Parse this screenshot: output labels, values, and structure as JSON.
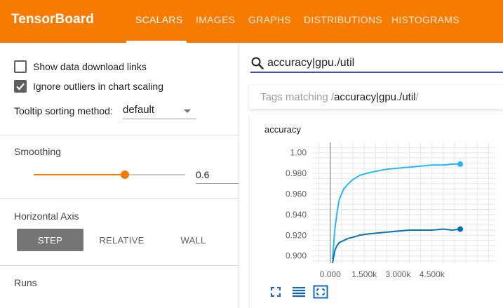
{
  "header": {
    "brand": "TensorBoard",
    "tabs": [
      {
        "label": "SCALARS",
        "active": true
      },
      {
        "label": "IMAGES",
        "active": false
      },
      {
        "label": "GRAPHS",
        "active": false
      },
      {
        "label": "DISTRIBUTIONS",
        "active": false
      },
      {
        "label": "HISTOGRAMS",
        "active": false
      }
    ],
    "accent_color": "#f57c00"
  },
  "sidebar": {
    "show_download_links": {
      "label": "Show data download links",
      "checked": false
    },
    "ignore_outliers": {
      "label": "Ignore outliers in chart scaling",
      "checked": true
    },
    "tooltip_sort": {
      "label": "Tooltip sorting method:",
      "value": "default"
    },
    "smoothing": {
      "title": "Smoothing",
      "value": "0.6",
      "fraction": 0.6
    },
    "horizontal_axis": {
      "title": "Horizontal Axis",
      "options": [
        "STEP",
        "RELATIVE",
        "WALL"
      ],
      "selected": "STEP"
    },
    "runs": {
      "title": "Runs"
    }
  },
  "search": {
    "value": "accuracy|gpu./util",
    "icon": "search-icon"
  },
  "tags": {
    "prefix": "Tags matching /",
    "pattern": "accuracy|gpu./util",
    "suffix": "/"
  },
  "chart_card": {
    "toolbar_icons": [
      "expand-icon",
      "list-icon",
      "fit-domain-icon"
    ]
  },
  "chart_data": {
    "type": "line",
    "title": "accuracy",
    "xlabel": "",
    "ylabel": "",
    "xlim": [
      -800,
      7300
    ],
    "ylim": [
      0.893,
      1.01
    ],
    "xticks": [
      0,
      1500,
      3000,
      4500
    ],
    "xtick_labels": [
      "0.000",
      "1.500k",
      "3.000k",
      "4.500k"
    ],
    "yticks": [
      1.0,
      0.98,
      0.96,
      0.94,
      0.92,
      0.9
    ],
    "ytick_labels": [
      "1.00",
      "0.980",
      "0.960",
      "0.940",
      "0.920",
      "0.900"
    ],
    "grid": true,
    "series": [
      {
        "color": "#29b6f6",
        "x": [
          100,
          200,
          300,
          400,
          600,
          800,
          1000,
          1300,
          1600,
          2000,
          2500,
          3000,
          3500,
          4000,
          4500,
          5000,
          5400,
          5750
        ],
        "y": [
          0.897,
          0.925,
          0.942,
          0.955,
          0.965,
          0.97,
          0.974,
          0.978,
          0.98,
          0.982,
          0.984,
          0.985,
          0.986,
          0.987,
          0.988,
          0.988,
          0.989,
          0.989
        ]
      },
      {
        "color": "#0b6fb3",
        "x": [
          100,
          200,
          300,
          400,
          600,
          800,
          1000,
          1300,
          1600,
          2000,
          2500,
          3000,
          3500,
          4000,
          4500,
          5000,
          5400,
          5750
        ],
        "y": [
          0.893,
          0.905,
          0.91,
          0.913,
          0.915,
          0.917,
          0.918,
          0.92,
          0.921,
          0.922,
          0.923,
          0.924,
          0.925,
          0.925,
          0.925,
          0.926,
          0.925,
          0.926
        ]
      }
    ]
  }
}
